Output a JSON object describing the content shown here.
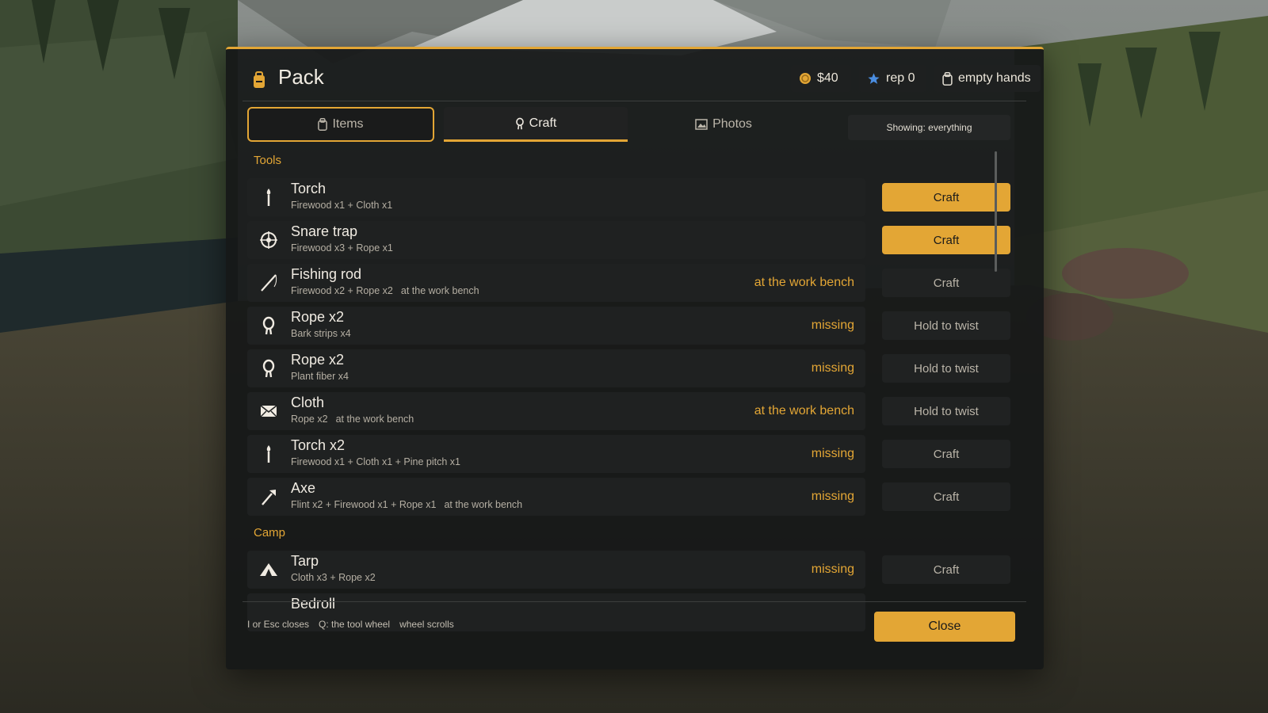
{
  "panel": {
    "title": "Pack",
    "title_icon": "backpack-icon",
    "money": "$40",
    "money_icon": "coin-icon",
    "rep": "rep 0",
    "rep_icon": "star-icon",
    "hands": "empty hands",
    "hands_icon": "backpack-small-icon",
    "accent_color": "#e3a635"
  },
  "tabs": [
    {
      "label": "Items",
      "icon": "backpack-small-icon",
      "state": "focused"
    },
    {
      "label": "Craft",
      "icon": "rope-icon",
      "state": "selected"
    },
    {
      "label": "Photos",
      "icon": "photo-icon",
      "state": "normal"
    }
  ],
  "filter": {
    "label": "Showing: everything"
  },
  "sections": [
    {
      "label": "Tools",
      "recipes": [
        {
          "name": "Torch",
          "recipe": "Firewood x1 + Cloth x1",
          "location": "",
          "status": "",
          "action": "Craft",
          "action_enabled": true,
          "icon": "torch-icon"
        },
        {
          "name": "Snare trap",
          "recipe": "Firewood x3 + Rope x1",
          "location": "",
          "status": "",
          "action": "Craft",
          "action_enabled": true,
          "icon": "snare-icon"
        },
        {
          "name": "Fishing rod",
          "recipe": "Firewood x2 + Rope x2",
          "location": "at the work bench",
          "status": "at the work bench",
          "action": "Craft",
          "action_enabled": false,
          "icon": "fishing-rod-icon"
        },
        {
          "name": "Rope x2",
          "recipe": "Bark strips x4",
          "location": "",
          "status": "missing",
          "action": "Hold to twist",
          "action_enabled": false,
          "icon": "rope-icon"
        },
        {
          "name": "Rope x2",
          "recipe": "Plant fiber x4",
          "location": "",
          "status": "missing",
          "action": "Hold to twist",
          "action_enabled": false,
          "icon": "rope-icon"
        },
        {
          "name": "Cloth",
          "recipe": "Rope x2",
          "location": "at the work bench",
          "status": "at the work bench",
          "action": "Hold to twist",
          "action_enabled": false,
          "icon": "cloth-icon"
        },
        {
          "name": "Torch x2",
          "recipe": "Firewood x1 + Cloth x1 + Pine pitch x1",
          "location": "",
          "status": "missing",
          "action": "Craft",
          "action_enabled": false,
          "icon": "torch-icon"
        },
        {
          "name": "Axe",
          "recipe": "Flint x2 + Firewood x1 + Rope x1",
          "location": "at the work bench",
          "status": "missing",
          "action": "Craft",
          "action_enabled": false,
          "icon": "axe-icon"
        }
      ]
    },
    {
      "label": "Camp",
      "recipes": [
        {
          "name": "Tarp",
          "recipe": "Cloth x3 + Rope x2",
          "location": "",
          "status": "missing",
          "action": "Craft",
          "action_enabled": false,
          "icon": "tent-icon"
        },
        {
          "name": "Bedroll",
          "recipe": "",
          "location": "",
          "status": "",
          "action": "",
          "action_enabled": false,
          "icon": ""
        }
      ]
    }
  ],
  "footer": {
    "hints": [
      "I or Esc closes",
      "Q: the tool wheel",
      "wheel scrolls"
    ],
    "close_label": "Close"
  }
}
